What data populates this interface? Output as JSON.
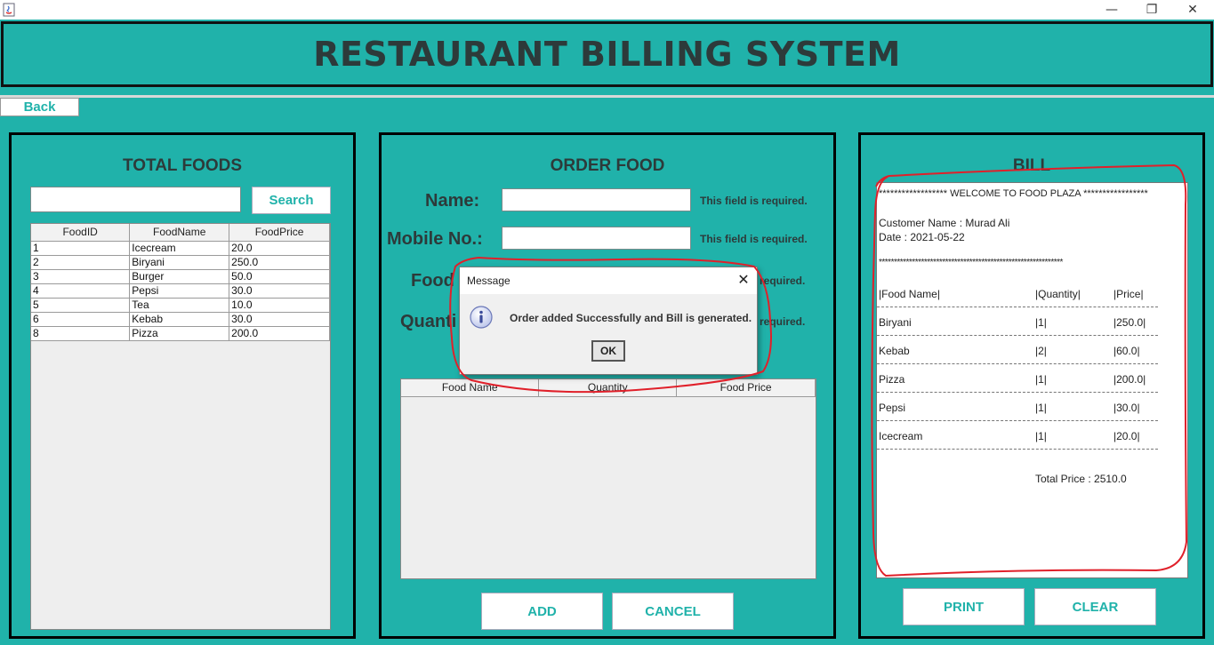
{
  "window": {
    "minimize_glyph": "—",
    "restore_glyph": "❐",
    "close_glyph": "✕"
  },
  "header": {
    "title": "RESTAURANT BILLING SYSTEM"
  },
  "back_label": "Back",
  "total_foods": {
    "title": "TOTAL FOODS",
    "search_value": "",
    "search_label": "Search",
    "columns": [
      "FoodID",
      "FoodName",
      "FoodPrice"
    ],
    "rows": [
      [
        "1",
        "Icecream",
        "20.0"
      ],
      [
        "2",
        "Biryani",
        "250.0"
      ],
      [
        "3",
        "Burger",
        "50.0"
      ],
      [
        "4",
        "Pepsi",
        "30.0"
      ],
      [
        "5",
        "Tea",
        "10.0"
      ],
      [
        "6",
        "Kebab",
        "30.0"
      ],
      [
        "8",
        "Pizza",
        "200.0"
      ]
    ]
  },
  "order_food": {
    "title": "ORDER FOOD",
    "name_label": "Name:",
    "mobile_label": "Mobile No.:",
    "food_label": "Food",
    "quantity_label": "Quanti",
    "required_msg": "This field is required.",
    "required_msg_partial": "required.",
    "name_value": "",
    "mobile_value": "",
    "columns": [
      "Food Name",
      "Quantity",
      "Food Price"
    ],
    "add_label": "ADD",
    "cancel_label": "CANCEL"
  },
  "bill": {
    "title": "BILL",
    "welcome_line": "****************** WELCOME TO FOOD PLAZA *****************",
    "customer_line": "Customer Name : Murad Ali",
    "date_line": "Date : 2021-05-22",
    "stars_line": "*************************************************************",
    "header_name": "|Food Name|",
    "header_qty": "|Quantity|",
    "header_price": "|Price|",
    "items": [
      {
        "name": "Biryani",
        "qty": "|1|",
        "price": "|250.0|"
      },
      {
        "name": "Kebab",
        "qty": "|2|",
        "price": "|60.0|"
      },
      {
        "name": "Pizza",
        "qty": "|1|",
        "price": "|200.0|"
      },
      {
        "name": "Pepsi",
        "qty": "|1|",
        "price": "|30.0|"
      },
      {
        "name": "Icecream",
        "qty": "|1|",
        "price": "|20.0|"
      }
    ],
    "total_line": "Total Price : 2510.0",
    "print_label": "PRINT",
    "clear_label": "CLEAR"
  },
  "dialog": {
    "title": "Message",
    "message": "Order added Successfully and Bill is generated.",
    "ok_label": "OK",
    "icon": "info-icon"
  },
  "colors": {
    "background": "#20b2aa",
    "heading_text": "#2d3a3a",
    "annotation": "#e0202a"
  }
}
